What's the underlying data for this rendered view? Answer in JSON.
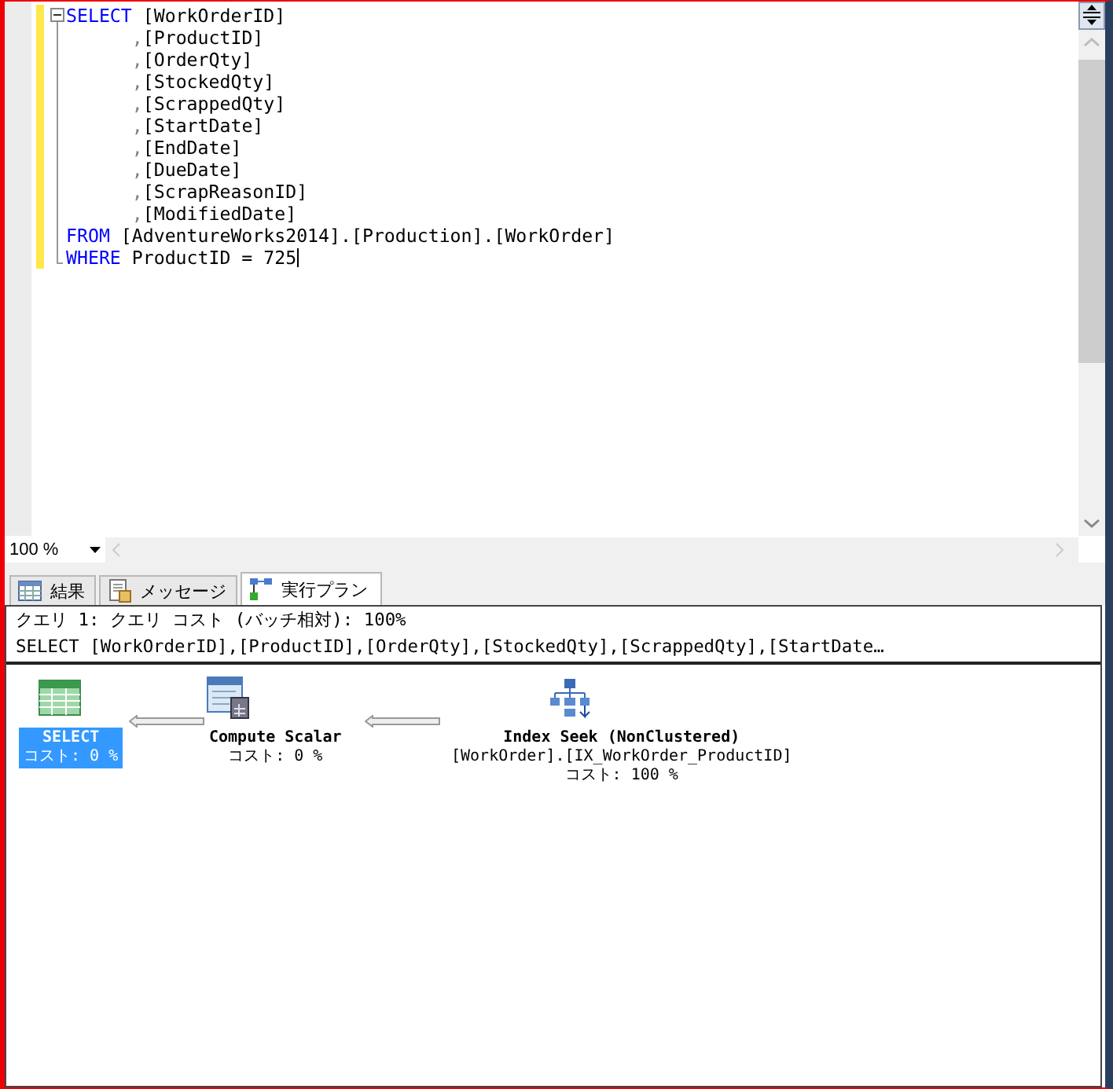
{
  "editor": {
    "lines": [
      [
        {
          "kind": "keyword",
          "text": "SELECT"
        },
        {
          "kind": "text",
          "text": " [WorkOrderID]"
        }
      ],
      [
        {
          "kind": "punct",
          "text": "      ,"
        },
        {
          "kind": "text",
          "text": "[ProductID]"
        }
      ],
      [
        {
          "kind": "punct",
          "text": "      ,"
        },
        {
          "kind": "text",
          "text": "[OrderQty]"
        }
      ],
      [
        {
          "kind": "punct",
          "text": "      ,"
        },
        {
          "kind": "text",
          "text": "[StockedQty]"
        }
      ],
      [
        {
          "kind": "punct",
          "text": "      ,"
        },
        {
          "kind": "text",
          "text": "[ScrappedQty]"
        }
      ],
      [
        {
          "kind": "punct",
          "text": "      ,"
        },
        {
          "kind": "text",
          "text": "[StartDate]"
        }
      ],
      [
        {
          "kind": "punct",
          "text": "      ,"
        },
        {
          "kind": "text",
          "text": "[EndDate]"
        }
      ],
      [
        {
          "kind": "punct",
          "text": "      ,"
        },
        {
          "kind": "text",
          "text": "[DueDate]"
        }
      ],
      [
        {
          "kind": "punct",
          "text": "      ,"
        },
        {
          "kind": "text",
          "text": "[ScrapReasonID]"
        }
      ],
      [
        {
          "kind": "punct",
          "text": "      ,"
        },
        {
          "kind": "text",
          "text": "[ModifiedDate]"
        }
      ],
      [
        {
          "kind": "keyword",
          "text": "FROM"
        },
        {
          "kind": "text",
          "text": " [AdventureWorks2014].[Production].[WorkOrder]"
        }
      ],
      [
        {
          "kind": "keyword",
          "text": "WHERE"
        },
        {
          "kind": "text",
          "text": " ProductID = 725"
        }
      ]
    ]
  },
  "zoom": {
    "value": "100 %"
  },
  "tabs": [
    {
      "label": "結果",
      "selected": false
    },
    {
      "label": "メッセージ",
      "selected": false
    },
    {
      "label": "実行プラン",
      "selected": true
    }
  ],
  "plan": {
    "header": "クエリ 1: クエリ コスト (バッチ相対): 100%",
    "query": "SELECT [WorkOrderID],[ProductID],[OrderQty],[StockedQty],[ScrappedQty],[StartDate…",
    "nodes": [
      {
        "lines": [
          "SELECT",
          "コスト: 0 %"
        ],
        "selected": true
      },
      {
        "lines": [
          "Compute Scalar",
          "コスト: 0 %"
        ],
        "selected": false
      },
      {
        "lines": [
          "Index Seek (NonClustered)",
          "[WorkOrder].[IX_WorkOrder_ProductID]",
          "コスト: 100 %"
        ],
        "selected": false
      }
    ]
  }
}
